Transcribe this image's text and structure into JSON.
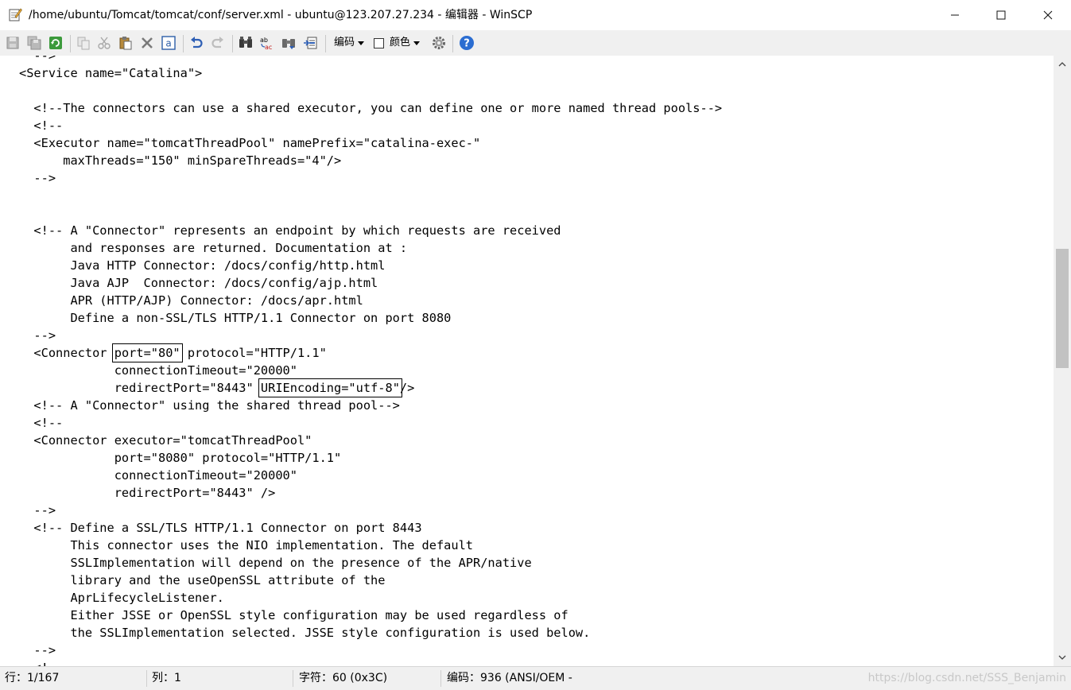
{
  "window": {
    "title": "/home/ubuntu/Tomcat/tomcat/conf/server.xml - ubuntu@123.207.27.234 - 编辑器 - WinSCP"
  },
  "toolbar": {
    "buttons": [
      "save-icon",
      "save-all-icon",
      "reload-icon",
      "copy-icon",
      "cut-icon",
      "paste-icon",
      "delete-icon",
      "select-all-icon",
      "undo-icon",
      "redo-icon",
      "find-icon",
      "replace-icon",
      "find-next-icon",
      "goto-line-icon"
    ],
    "encoding_label": "编码",
    "color_label": "颜色",
    "color_checked": false,
    "settings_icon": "gear-icon",
    "help_icon": "help-icon"
  },
  "editor": {
    "lines": [
      "  -->",
      "<Service name=\"Catalina\">",
      "",
      "  <!--The connectors can use a shared executor, you can define one or more named thread pools-->",
      "  <!--",
      "  <Executor name=\"tomcatThreadPool\" namePrefix=\"catalina-exec-\"",
      "      maxThreads=\"150\" minSpareThreads=\"4\"/>",
      "  -->",
      "",
      "",
      "  <!-- A \"Connector\" represents an endpoint by which requests are received",
      "       and responses are returned. Documentation at :",
      "       Java HTTP Connector: /docs/config/http.html",
      "       Java AJP  Connector: /docs/config/ajp.html",
      "       APR (HTTP/AJP) Connector: /docs/apr.html",
      "       Define a non-SSL/TLS HTTP/1.1 Connector on port 8080",
      "  -->",
      "",
      "",
      "",
      "  <!-- A \"Connector\" using the shared thread pool-->",
      "  <!--",
      "  <Connector executor=\"tomcatThreadPool\"",
      "             port=\"8080\" protocol=\"HTTP/1.1\"",
      "             connectionTimeout=\"20000\"",
      "             redirectPort=\"8443\" />",
      "  -->",
      "  <!-- Define a SSL/TLS HTTP/1.1 Connector on port 8443",
      "       This connector uses the NIO implementation. The default",
      "       SSLImplementation will depend on the presence of the APR/native",
      "       library and the useOpenSSL attribute of the",
      "       AprLifecycleListener.",
      "       Either JSSE or OpenSSL style configuration may be used regardless of",
      "       the SSLImplementation selected. JSSE style configuration is used below.",
      "  -->",
      "  <!--"
    ],
    "connector": {
      "line1_prefix": "  <Connector ",
      "line1_highlight": "port=\"80\"",
      "line1_suffix": " protocol=\"HTTP/1.1\"",
      "line2": "             connectionTimeout=\"20000\"",
      "line3_prefix": "             redirectPort=\"8443\" ",
      "line3_highlight": "URIEncoding=\"utf-8\"",
      "line3_suffix": "/>"
    }
  },
  "statusbar": {
    "line": "行：1/167",
    "column": "列：1",
    "char": "字符：60 (0x3C)",
    "encoding": "编码：936  (ANSI/OEM -",
    "watermark": "https://blog.csdn.net/SSS_Benjamin"
  }
}
